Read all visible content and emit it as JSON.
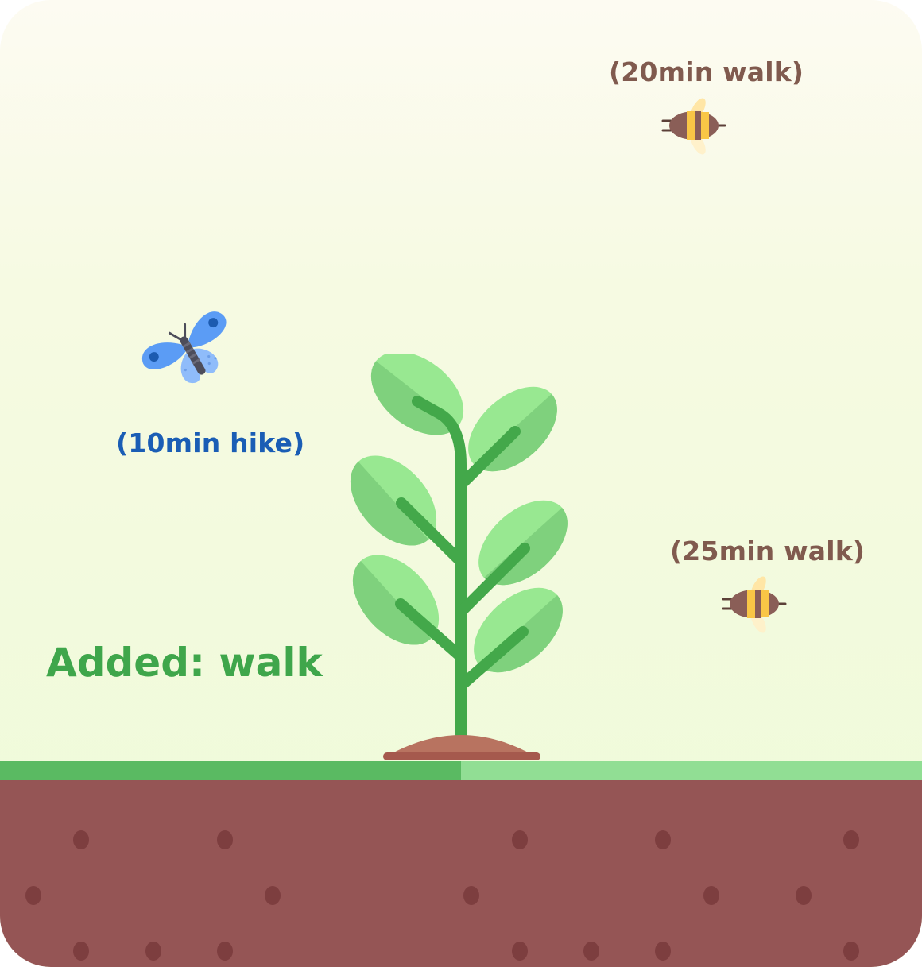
{
  "creatures": {
    "butterfly": {
      "label": "(10min hike)",
      "icon": "butterfly-icon",
      "color": "#1a5db5"
    },
    "bee_top": {
      "label": "(20min walk)",
      "icon": "bee-icon",
      "color": "#805a4e"
    },
    "bee_right": {
      "label": "(25min walk)",
      "icon": "bee-icon",
      "color": "#805a4e"
    }
  },
  "status": {
    "text": "Added: walk",
    "color": "#3fa64b"
  },
  "plant": {
    "icon": "plant-icon"
  },
  "ground": {
    "progress_fraction": 0.5,
    "filled_color": "#5aba62",
    "empty_color": "#91de94",
    "soil_color": "#955555"
  }
}
